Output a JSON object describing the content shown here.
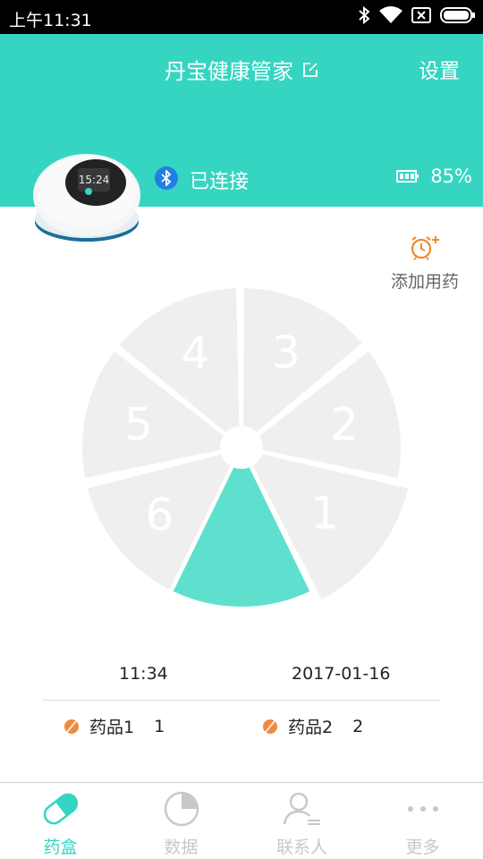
{
  "status_bar": {
    "time": "上午11:31",
    "icons": [
      "bluetooth-icon",
      "wifi-icon",
      "sim-off-icon",
      "battery-icon"
    ]
  },
  "header": {
    "title": "丹宝健康管家",
    "settings_label": "设置",
    "connection_status": "已连接",
    "battery_percent": "85%",
    "device_screen_time": "15:24",
    "accent_color": "#35d5c1",
    "bluetooth_badge_color": "#1f7fe6"
  },
  "add_medication": {
    "label": "添加用药",
    "icon": "alarm-clock-plus-icon",
    "icon_color": "#f08a2c"
  },
  "pill_box": {
    "compartments": [
      "1",
      "2",
      "3",
      "4",
      "5",
      "6"
    ],
    "active_compartment": "1",
    "active_color": "#5fe0ce",
    "inactive_color": "#efefef"
  },
  "schedule": {
    "time": "11:34",
    "date": "2017-01-16"
  },
  "medications": [
    {
      "name": "药品1",
      "count": "1"
    },
    {
      "name": "药品2",
      "count": "2"
    }
  ],
  "tabs": [
    {
      "label": "药盒",
      "icon": "pill-capsule-icon",
      "active": true
    },
    {
      "label": "数据",
      "icon": "pie-chart-icon",
      "active": false
    },
    {
      "label": "联系人",
      "icon": "contacts-icon",
      "active": false
    },
    {
      "label": "更多",
      "icon": "more-dots-icon",
      "active": false
    }
  ]
}
